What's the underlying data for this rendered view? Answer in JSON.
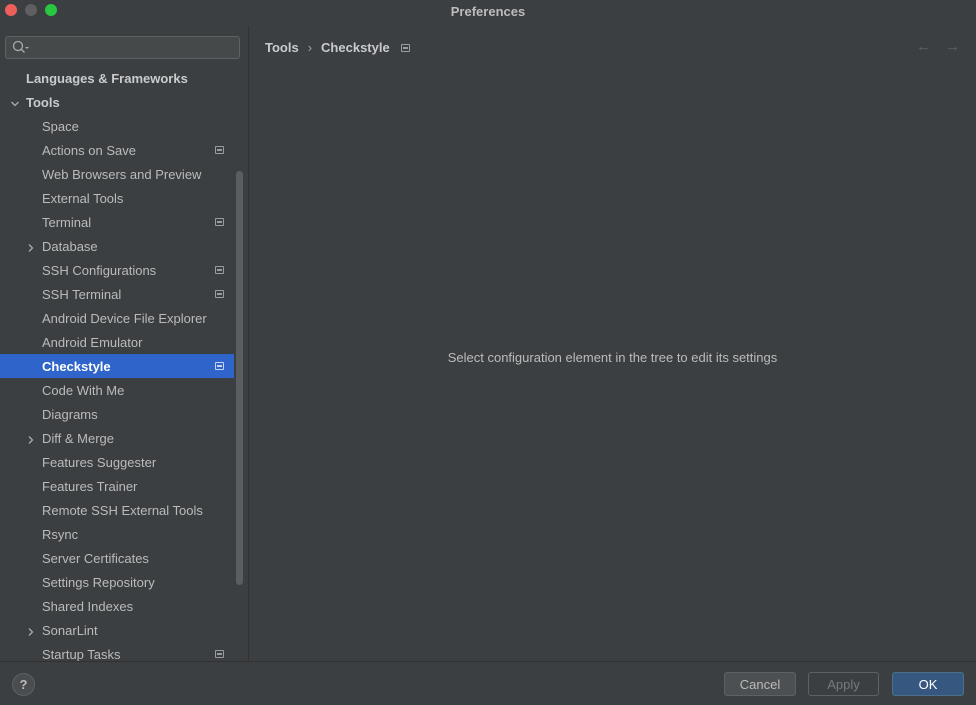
{
  "window": {
    "title": "Preferences"
  },
  "search": {
    "placeholder": "",
    "value": ""
  },
  "tree": {
    "items": [
      {
        "label": "Languages & Frameworks",
        "level": 0,
        "bold": true,
        "expandable": false,
        "project": false,
        "selected": false
      },
      {
        "label": "Tools",
        "level": 0,
        "bold": true,
        "expanded": true,
        "expandable": true,
        "project": false,
        "selected": false
      },
      {
        "label": "Space",
        "level": 1,
        "expandable": false,
        "project": false,
        "selected": false
      },
      {
        "label": "Actions on Save",
        "level": 1,
        "expandable": false,
        "project": true,
        "selected": false
      },
      {
        "label": "Web Browsers and Preview",
        "level": 1,
        "expandable": false,
        "project": false,
        "selected": false
      },
      {
        "label": "External Tools",
        "level": 1,
        "expandable": false,
        "project": false,
        "selected": false
      },
      {
        "label": "Terminal",
        "level": 1,
        "expandable": false,
        "project": true,
        "selected": false
      },
      {
        "label": "Database",
        "level": 1,
        "expandable": true,
        "project": false,
        "selected": false
      },
      {
        "label": "SSH Configurations",
        "level": 1,
        "expandable": false,
        "project": true,
        "selected": false
      },
      {
        "label": "SSH Terminal",
        "level": 1,
        "expandable": false,
        "project": true,
        "selected": false
      },
      {
        "label": "Android Device File Explorer",
        "level": 1,
        "expandable": false,
        "project": false,
        "selected": false
      },
      {
        "label": "Android Emulator",
        "level": 1,
        "expandable": false,
        "project": false,
        "selected": false
      },
      {
        "label": "Checkstyle",
        "level": 1,
        "expandable": false,
        "project": true,
        "selected": true
      },
      {
        "label": "Code With Me",
        "level": 1,
        "expandable": false,
        "project": false,
        "selected": false
      },
      {
        "label": "Diagrams",
        "level": 1,
        "expandable": false,
        "project": false,
        "selected": false
      },
      {
        "label": "Diff & Merge",
        "level": 1,
        "expandable": true,
        "project": false,
        "selected": false
      },
      {
        "label": "Features Suggester",
        "level": 1,
        "expandable": false,
        "project": false,
        "selected": false
      },
      {
        "label": "Features Trainer",
        "level": 1,
        "expandable": false,
        "project": false,
        "selected": false
      },
      {
        "label": "Remote SSH External Tools",
        "level": 1,
        "expandable": false,
        "project": false,
        "selected": false
      },
      {
        "label": "Rsync",
        "level": 1,
        "expandable": false,
        "project": false,
        "selected": false
      },
      {
        "label": "Server Certificates",
        "level": 1,
        "expandable": false,
        "project": false,
        "selected": false
      },
      {
        "label": "Settings Repository",
        "level": 1,
        "expandable": false,
        "project": false,
        "selected": false
      },
      {
        "label": "Shared Indexes",
        "level": 1,
        "expandable": false,
        "project": false,
        "selected": false
      },
      {
        "label": "SonarLint",
        "level": 1,
        "expandable": true,
        "project": false,
        "selected": false
      },
      {
        "label": "Startup Tasks",
        "level": 1,
        "expandable": false,
        "project": true,
        "selected": false
      }
    ]
  },
  "breadcrumb": {
    "parent": "Tools",
    "separator": "›",
    "current": "Checkstyle"
  },
  "nav": {
    "back": "←",
    "forward": "→"
  },
  "main": {
    "message": "Select configuration element in the tree to edit its settings"
  },
  "footer": {
    "help": "?",
    "cancel": "Cancel",
    "apply": "Apply",
    "ok": "OK"
  },
  "colors": {
    "background": "#3c3f41",
    "selection": "#2f65ca",
    "primary_button": "#365880"
  }
}
